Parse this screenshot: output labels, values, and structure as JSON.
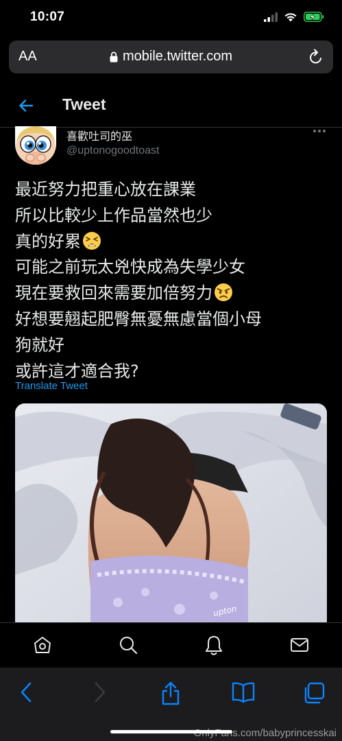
{
  "status_bar": {
    "time": "10:07",
    "icons": [
      "signal-icon",
      "wifi-icon",
      "battery-charging-icon"
    ]
  },
  "browser": {
    "aa_label": "AA",
    "url": "mobile.twitter.com",
    "icons": [
      "lock-icon",
      "reload-icon"
    ]
  },
  "header": {
    "title": "Tweet",
    "back_icon": "back-arrow-icon"
  },
  "tweet": {
    "author": {
      "display_name": "喜歡吐司的巫",
      "handle": "@uptonogoodtoast",
      "avatar": "avatar-cartoon"
    },
    "text_lines": [
      "最近努力把重心放在課業",
      "所以比較少上作品當然也少",
      "真的好累",
      "可能之前玩太兇快成為失學少女",
      "現在要救回來需要加倍努力",
      "好想要翹起肥臀無憂無慮當個小母",
      "狗就好",
      "或許這才適合我?"
    ],
    "emojis": [
      "tired-face-emoji",
      "angry-face-emoji"
    ],
    "translate_label": "Translate Tweet",
    "photo": "photo-person-on-bed",
    "photo_watermark": "upton"
  },
  "bottom_nav": {
    "items": [
      "home-icon",
      "search-icon",
      "notifications-icon",
      "messages-icon"
    ]
  },
  "safari_toolbar": {
    "items": [
      "back-icon",
      "forward-icon",
      "share-icon",
      "bookmarks-icon",
      "tabs-icon"
    ]
  },
  "watermark": "OnlyFans.com/babyprincesskai",
  "colors": {
    "accent": "#1d9bf0",
    "background": "#000000",
    "text": "#e7e9ea",
    "muted": "#71767b",
    "battery": "#30d158"
  }
}
